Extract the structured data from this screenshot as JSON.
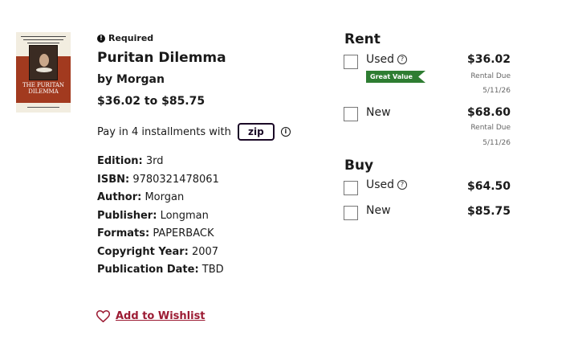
{
  "book": {
    "required_label": "Required",
    "title": "Puritan Dilemma",
    "author_line": "by Morgan",
    "price_range": "$36.02 to $85.75",
    "cover_title": "THE PURITAN DILEMMA"
  },
  "payment": {
    "installments_text": "Pay in 4 installments with",
    "provider_badge": "zip"
  },
  "details": [
    {
      "label": "Edition:",
      "value": "3rd"
    },
    {
      "label": "ISBN:",
      "value": "9780321478061"
    },
    {
      "label": "Author:",
      "value": "Morgan"
    },
    {
      "label": "Publisher:",
      "value": "Longman"
    },
    {
      "label": "Formats:",
      "value": "PAPERBACK"
    },
    {
      "label": "Copyright Year:",
      "value": "2007"
    },
    {
      "label": "Publication Date:",
      "value": "TBD"
    }
  ],
  "wishlist": {
    "label": "Add to Wishlist",
    "color": "#9c1b33"
  },
  "rent": {
    "heading": "Rent",
    "options": [
      {
        "label": "Used",
        "price": "$36.02",
        "due_label": "Rental Due",
        "due_date": "5/11/26",
        "badge": "Great Value"
      },
      {
        "label": "New",
        "price": "$68.60",
        "due_label": "Rental Due",
        "due_date": "5/11/26"
      }
    ]
  },
  "buy": {
    "heading": "Buy",
    "options": [
      {
        "label": "Used",
        "price": "$64.50"
      },
      {
        "label": "New",
        "price": "$85.75"
      }
    ]
  },
  "colors": {
    "badge_green": "#2e7d32",
    "cover_red": "#a23a1f"
  }
}
